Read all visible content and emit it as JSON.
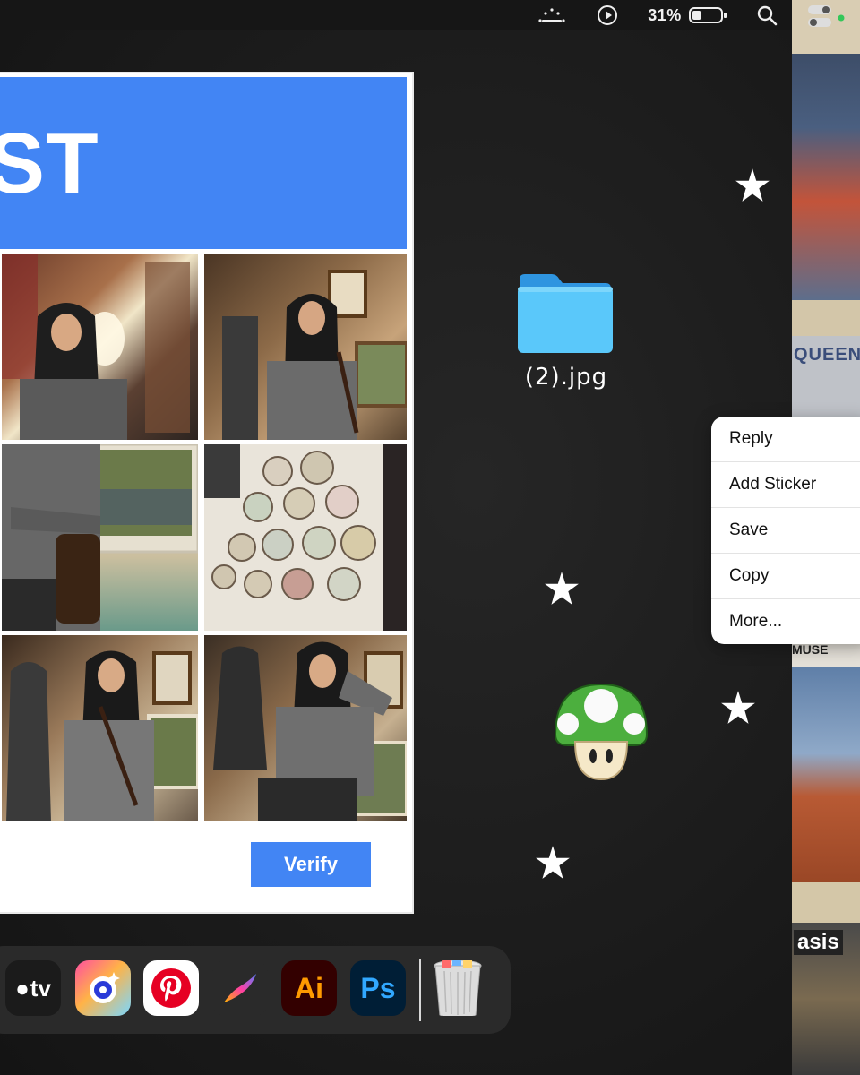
{
  "menubar": {
    "battery_percent": "31%",
    "battery_level": 0.31,
    "icons": [
      "cloud-dots-icon",
      "play-circle-icon",
      "battery-icon",
      "search-icon",
      "control-center-icon"
    ]
  },
  "captcha": {
    "title_fragment": "ST",
    "verify_label": "Verify",
    "tiles": [
      "mirror-selfie-photo",
      "posing-in-gallery-photo",
      "arms-crossed-photo",
      "decorative-plates-wall-photo",
      "two-people-gallery-photo",
      "hand-on-head-pose-photo"
    ]
  },
  "desktop": {
    "folder_label": "(2).jpg",
    "icons": [
      "folder-icon",
      "mushroom-sticker",
      "star-sticker"
    ]
  },
  "context_menu": {
    "items": [
      "Reply",
      "Add Sticker",
      "Save",
      "Copy",
      "More..."
    ]
  },
  "right_strip": {
    "posters": [
      {
        "text": "QUEEN"
      },
      {
        "text": "MUSE"
      },
      {
        "text": "asis"
      }
    ]
  },
  "dock": {
    "apps": [
      {
        "name": "apple-tv-icon",
        "label": "tv"
      },
      {
        "name": "camera-app-icon",
        "label": ""
      },
      {
        "name": "pinterest-icon",
        "label": ""
      },
      {
        "name": "procreate-icon",
        "label": ""
      },
      {
        "name": "illustrator-icon",
        "label": "Ai"
      },
      {
        "name": "photoshop-icon",
        "label": "Ps"
      },
      {
        "name": "trash-icon",
        "label": ""
      }
    ]
  },
  "colors": {
    "captcha_blue": "#4285f4",
    "folder_blue": "#5ac8fa",
    "desktop": "#1c1c1c",
    "menu_bg": "#ffffff"
  }
}
